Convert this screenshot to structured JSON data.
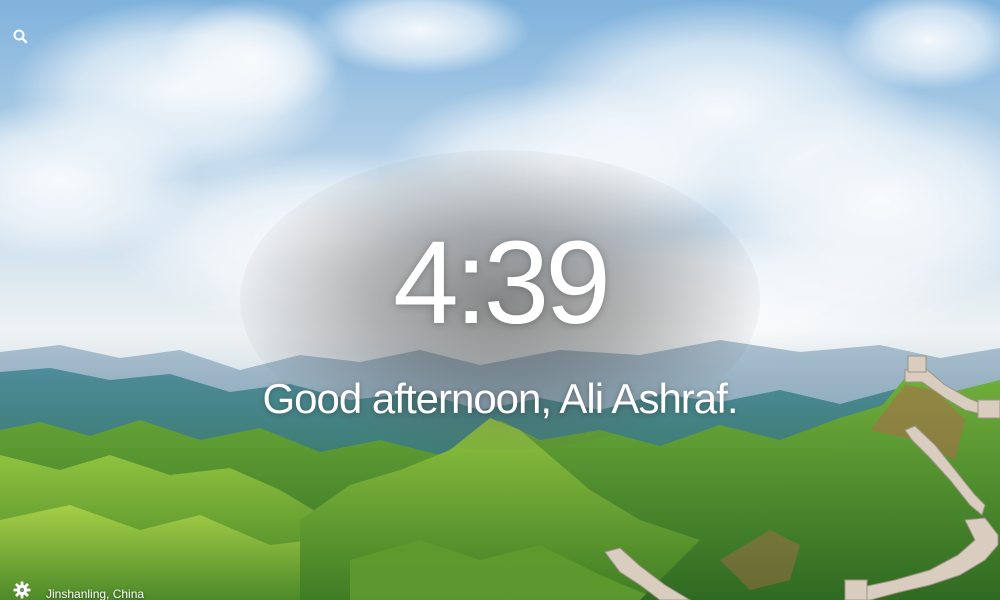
{
  "app": {
    "kind": "new-tab-dashboard"
  },
  "toolbar": {
    "search_icon": "search-icon",
    "settings_icon": "gear-icon"
  },
  "clock": {
    "time": "4:39"
  },
  "greeting": {
    "text": "Good afternoon, Ali Ashraf."
  },
  "background": {
    "location": "Jinshanling, China"
  },
  "colors": {
    "text": "#ffffff",
    "sky": "#9cc3e2",
    "hills": "#4f8f2f"
  }
}
